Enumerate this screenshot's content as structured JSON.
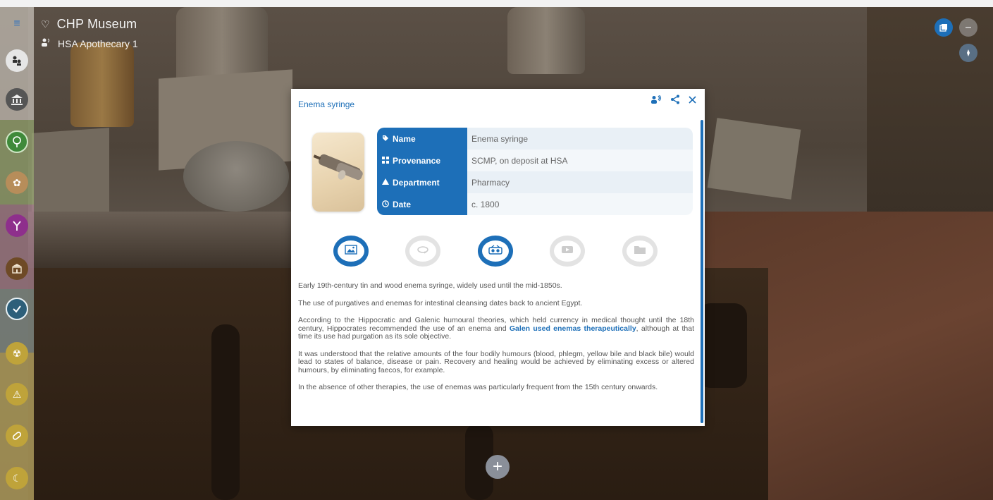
{
  "header": {
    "museum_title": "CHP Museum",
    "location": "HSA Apothecary 1"
  },
  "modal": {
    "title": "Enema syringe",
    "info": {
      "name_label": "Name",
      "name_value": "Enema syringe",
      "provenance_label": "Provenance",
      "provenance_value": "SCMP, on deposit at HSA",
      "department_label": "Department",
      "department_value": "Pharmacy",
      "date_label": "Date",
      "date_value": "c. 1800"
    },
    "media_tabs": [
      {
        "icon": "image-icon",
        "active": true
      },
      {
        "icon": "rotate-360-icon",
        "active": false
      },
      {
        "icon": "glasses-vr-icon",
        "active": true
      },
      {
        "icon": "video-icon",
        "active": false
      },
      {
        "icon": "folder-icon",
        "active": false
      }
    ],
    "description": {
      "p1": "Early 19th-century tin and wood enema syringe, widely used until the mid-1850s.",
      "p2": "The use of purgatives and enemas for intestinal cleansing dates back to ancient Egypt.",
      "p3_before": "According to the Hippocratic and Galenic humoural theories, which held currency in medical thought until the 18th century, Hippocrates recommended the use of an enema and ",
      "p3_link": "Galen used enemas therapeutically",
      "p3_after": ", although at that time its use had purgation as its sole objective.",
      "p4": "It was understood that the relative amounts of the four bodily humours (blood, phlegm, yellow bile and black bile) would lead to states of balance, disease or pain. Recovery and healing would be achieved by eliminating excess or altered humours, by eliminating faecos, for example.",
      "p5": "In the absence of other therapies, the use of enemas was particularly frequent from the 15th century onwards."
    }
  },
  "colors": {
    "accent": "#1d6fb8",
    "rail": "#c4b096"
  }
}
